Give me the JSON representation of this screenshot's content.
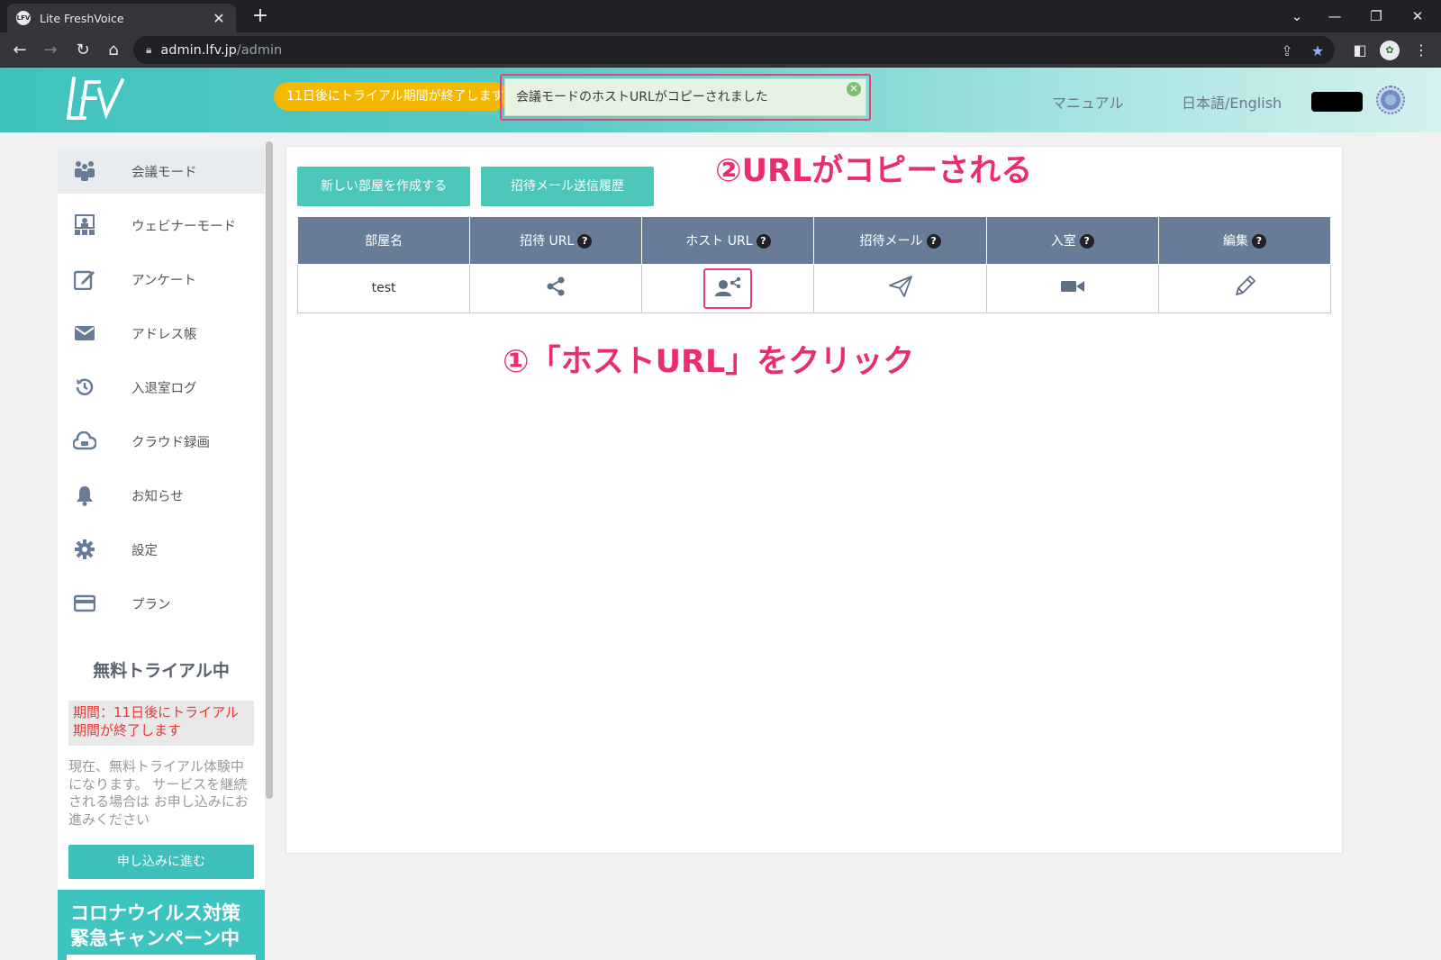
{
  "browser": {
    "tab_title": "Lite FreshVoice",
    "tab_favicon_text": "LFV",
    "close_glyph": "✕",
    "newtab_glyph": "+",
    "url_host": "admin.lfv.jp",
    "url_path": "/admin"
  },
  "header": {
    "trial_pill": "11日後にトライアル期間が終了します",
    "toast": "会議モードのホストURLがコピーされました",
    "links": {
      "manual": "マニュアル",
      "language": "日本語/English"
    }
  },
  "sidebar": {
    "items": [
      {
        "label": "会議モード",
        "icon": "meeting-icon"
      },
      {
        "label": "ウェビナーモード",
        "icon": "webinar-icon"
      },
      {
        "label": "アンケート",
        "icon": "survey-icon"
      },
      {
        "label": "アドレス帳",
        "icon": "mail-icon"
      },
      {
        "label": "入退室ログ",
        "icon": "history-icon"
      },
      {
        "label": "クラウド録画",
        "icon": "cloud-record-icon"
      },
      {
        "label": "お知らせ",
        "icon": "bell-icon"
      },
      {
        "label": "設定",
        "icon": "gear-icon"
      },
      {
        "label": "プラン",
        "icon": "card-icon"
      }
    ],
    "trial": {
      "title": "無料トライアル中",
      "period": "期間：11日後にトライアル期間が終了します",
      "description": "現在、無料トライアル体験中 になります。 サービスを継続される場合は お申し込みにお進みください",
      "apply_button": "申し込みに進む"
    },
    "campaign": "コロナウイルス対策緊急キャンペーン中"
  },
  "main": {
    "buttons": {
      "create_room": "新しい部屋を作成する",
      "invite_history": "招待メール送信履歴"
    },
    "annotations": {
      "step2": "②URLがコピーされる",
      "step1": "①「ホストURL」をクリック"
    },
    "table": {
      "headers": [
        "部屋名",
        "招待 URL",
        "ホスト URL",
        "招待メール",
        "入室",
        "編集"
      ],
      "rows": [
        {
          "room_name": "test"
        }
      ]
    }
  },
  "colors": {
    "accent_teal": "#3fc2be",
    "annotation_pink": "#ea2d6b",
    "table_header": "#687c98",
    "trial_yellow": "#f5b800"
  }
}
